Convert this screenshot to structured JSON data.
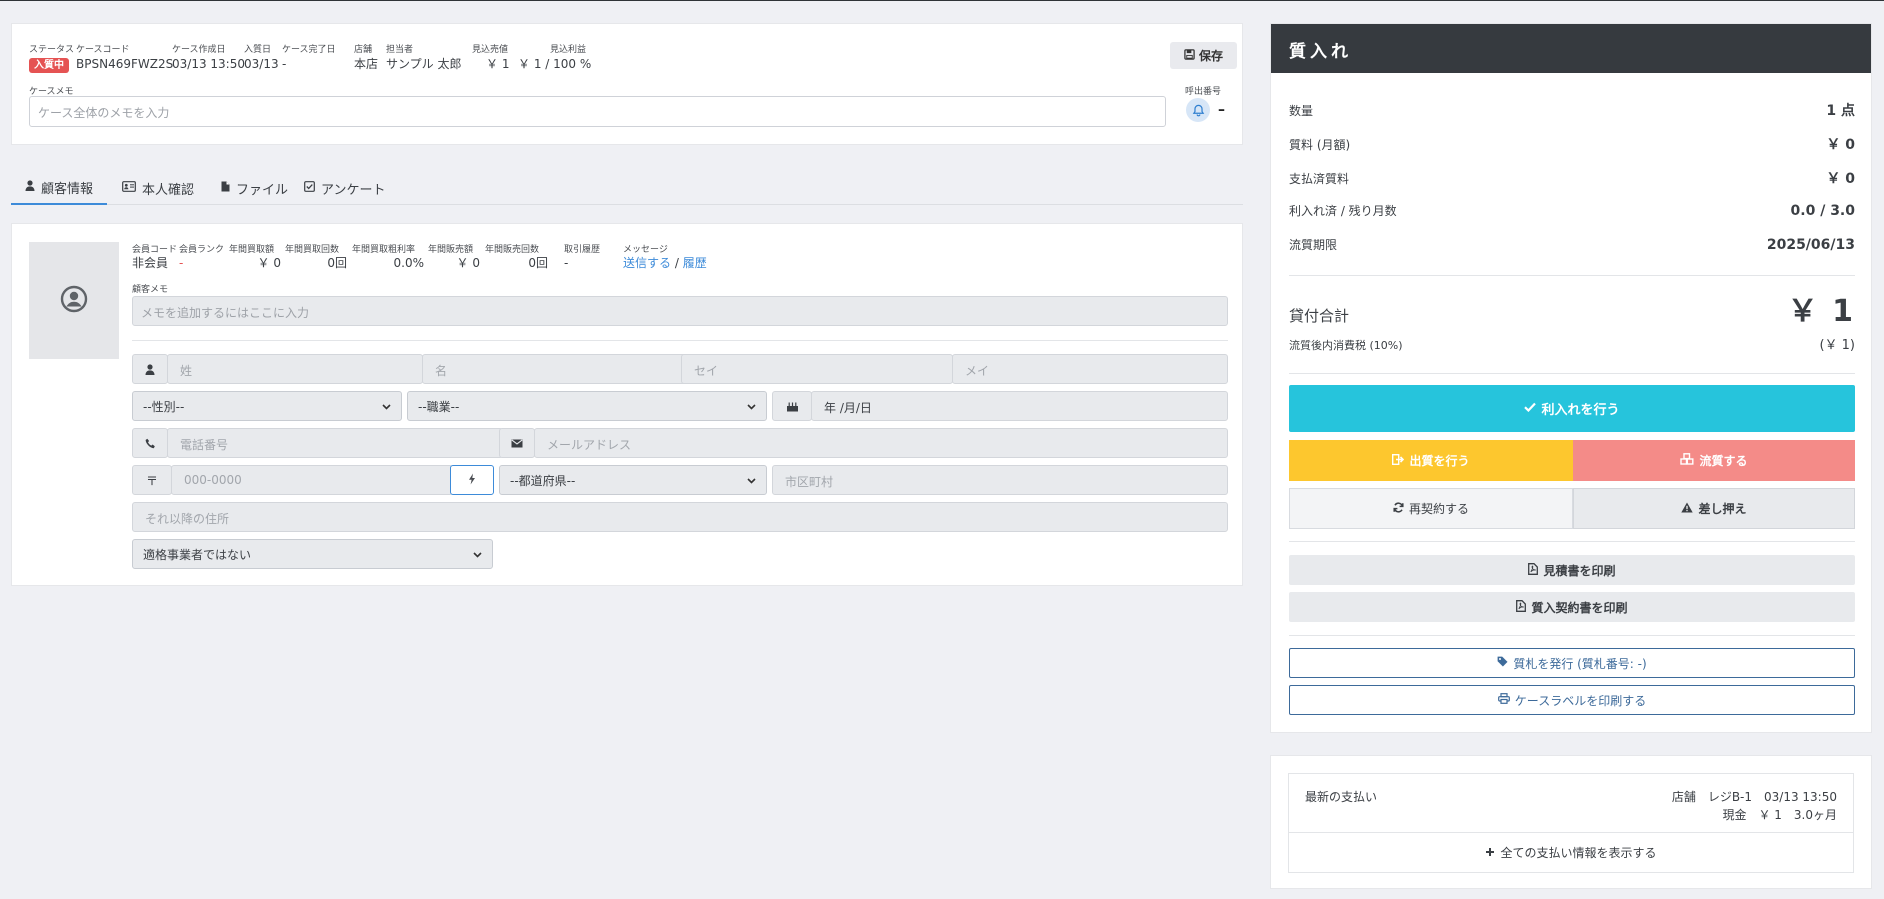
{
  "case": {
    "status_label": "ステータス",
    "status_value": "入質中",
    "code_label": "ケースコード",
    "code_value": "BPSN469FWZ2S",
    "created_label": "ケース作成日",
    "created_value": "03/13 13:50",
    "pawn_date_label": "入質日",
    "pawn_date_value": "03/13",
    "completed_label": "ケース完了日",
    "completed_value": "-",
    "store_label": "店舗",
    "store_value": "本店",
    "staff_label": "担当者",
    "staff_value": "サンプル 太郎",
    "est_sale_label": "見込売値",
    "est_sale_value": "￥ 1",
    "est_profit_label": "見込利益",
    "est_profit_value": "￥ 1 / 100 %",
    "save_label": "保存",
    "memo_label": "ケースメモ",
    "memo_placeholder": "ケース全体のメモを入力",
    "call_label": "呼出番号",
    "call_value": "–"
  },
  "tabs": [
    {
      "label": "顧客情報",
      "icon": "user-icon"
    },
    {
      "label": "本人確認",
      "icon": "id-card-icon"
    },
    {
      "label": "ファイル",
      "icon": "file-icon"
    },
    {
      "label": "アンケート",
      "icon": "check-square-icon"
    }
  ],
  "customer": {
    "stats": [
      {
        "label": "会員コード",
        "value": "非会員"
      },
      {
        "label": "会員ランク",
        "value": "-"
      },
      {
        "label": "年間買取額",
        "value": "￥ 0"
      },
      {
        "label": "年間買取回数",
        "value": "0回"
      },
      {
        "label": "年間買取粗利率",
        "value": "0.0%"
      },
      {
        "label": "年間販売額",
        "value": "￥ 0"
      },
      {
        "label": "年間販売回数",
        "value": "0回"
      },
      {
        "label": "取引履歴",
        "value": "-"
      },
      {
        "label": "メッセージ",
        "send": "送信する",
        "sep": "/",
        "history": "履歴"
      }
    ],
    "memo_label": "顧客メモ",
    "memo_placeholder": "メモを追加するにはここに入力",
    "last_name_ph": "姓",
    "first_name_ph": "名",
    "last_kana_ph": "セイ",
    "first_kana_ph": "メイ",
    "gender_value": "--性別--",
    "job_value": "--職業--",
    "birthday_ph": "年 /月/日",
    "phone_ph": "電話番号",
    "email_ph": "メールアドレス",
    "zip_symbol": "〒",
    "zip_ph": "000-0000",
    "pref_value": "--都道府県--",
    "city_ph": "市区町村",
    "address_ph": "それ以降の住所",
    "invoice_value": "適格事業者ではない"
  },
  "pawn": {
    "title": "質入れ",
    "rows": [
      {
        "label": "数量",
        "value": "1 点"
      },
      {
        "label": "質料 (月額)",
        "value": "￥ 0"
      },
      {
        "label": "支払済質料",
        "value": "￥ 0"
      },
      {
        "label": "利入れ済 / 残り月数",
        "value": "0.0 / 3.0"
      },
      {
        "label": "流質期限",
        "value": "2025/06/13"
      }
    ],
    "total_label": "貸付合計",
    "total_value": "￥ 1",
    "tax_label": "流質後内消費税 (10%)",
    "tax_value": "(￥ 1)",
    "btn_interest": "利入れを行う",
    "btn_redeem": "出質を行う",
    "btn_forfeit": "流質する",
    "btn_renew": "再契約する",
    "btn_seize": "差し押え",
    "btn_print_estimate": "見積書を印刷",
    "btn_print_contract": "質入契約書を印刷",
    "btn_tag": "質札を発行 (質札番号: -)",
    "btn_label": "ケースラベルを印刷する",
    "colors": {
      "interest": "#26c4dc",
      "redeem": "#fdc72e",
      "forfeit": "#f48b88"
    }
  },
  "payment": {
    "title": "最新の支払い",
    "line1": "店舗　レジB-1　03/13 13:50",
    "line2": "現金　￥ 1　3.0ヶ月",
    "show_all": "全ての支払い情報を表示する"
  }
}
